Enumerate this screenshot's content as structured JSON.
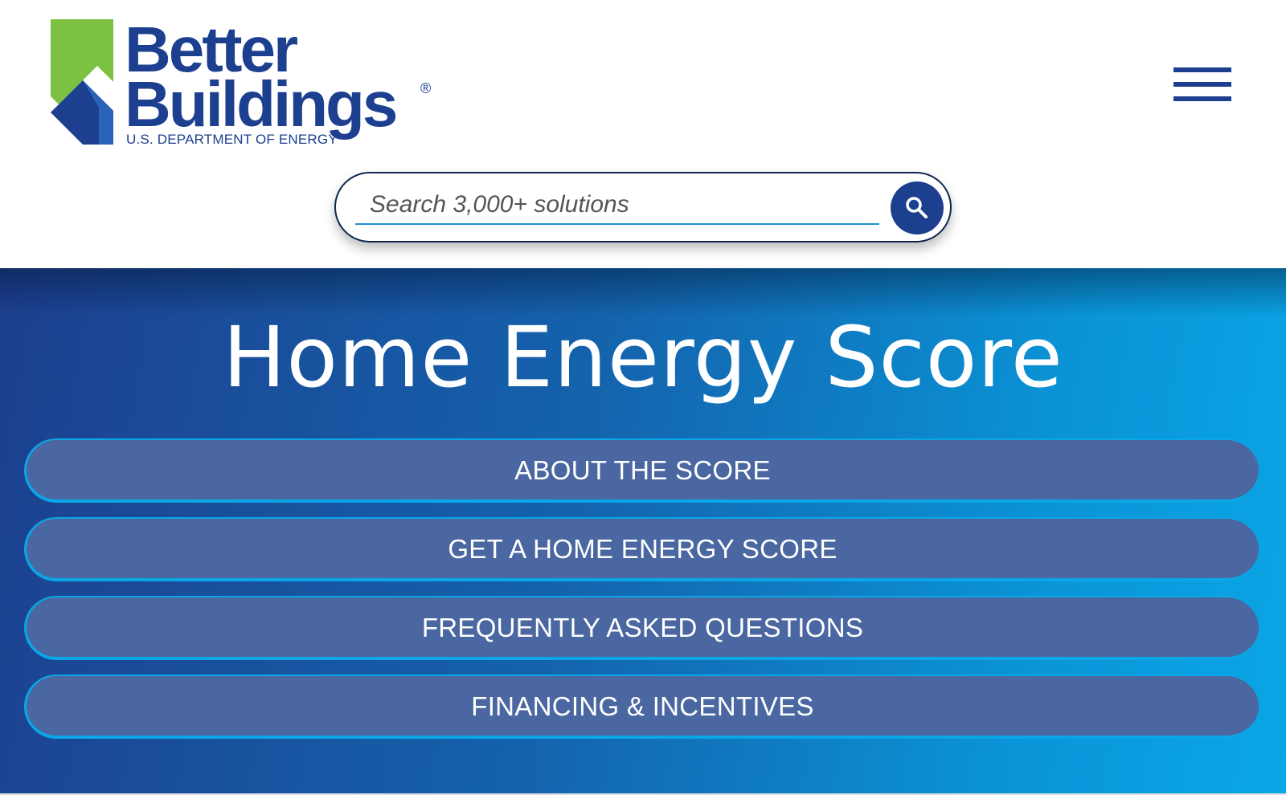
{
  "header": {
    "logo": {
      "word1": "Better",
      "word2": "Buildings",
      "registered": "®",
      "department": "U.S. DEPARTMENT OF ENERGY",
      "colors": {
        "green": "#7dc142",
        "blue": "#1d3f8f"
      }
    },
    "menu_icon": "hamburger-menu-icon",
    "search": {
      "placeholder": "Search 3,000+ solutions",
      "value": "",
      "button_icon": "search-icon"
    }
  },
  "hero": {
    "title": "Home Energy Score",
    "nav": [
      {
        "label": "ABOUT THE SCORE"
      },
      {
        "label": "GET A HOME ENERGY SCORE"
      },
      {
        "label": "FREQUENTLY ASKED QUESTIONS"
      },
      {
        "label": "FINANCING & INCENTIVES"
      }
    ],
    "colors": {
      "gradient_start": "#1d3f8f",
      "gradient_end": "#0aa6e6",
      "pill": "#4a67a1",
      "pill_border": "#0aa6e6"
    }
  }
}
